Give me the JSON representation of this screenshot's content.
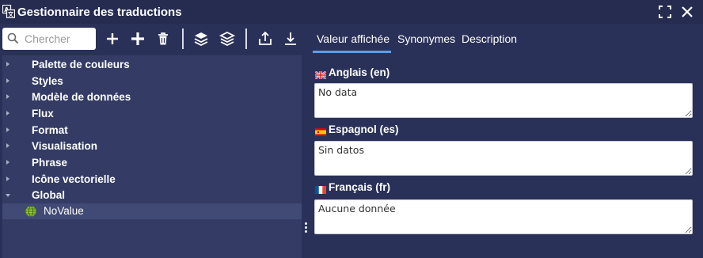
{
  "window": {
    "title": "Gestionnaire des traductions",
    "icon": "translate-icon",
    "controls": [
      "fullscreen-icon",
      "close-icon"
    ]
  },
  "toolbar": {
    "search_placeholder": "Chercher",
    "buttons": [
      "add-icon",
      "add-bold-icon",
      "trash-icon",
      "layers-icon",
      "layers-alt-icon",
      "export-icon",
      "download-icon"
    ]
  },
  "tree": {
    "items": [
      {
        "label": "Palette de couleurs",
        "expanded": false
      },
      {
        "label": "Styles",
        "expanded": false
      },
      {
        "label": "Modèle de données",
        "expanded": false
      },
      {
        "label": "Flux",
        "expanded": false
      },
      {
        "label": "Format",
        "expanded": false
      },
      {
        "label": "Visualisation",
        "expanded": false
      },
      {
        "label": "Phrase",
        "expanded": false
      },
      {
        "label": "Icône vectorielle",
        "expanded": false
      },
      {
        "label": "Global",
        "expanded": true
      }
    ],
    "selected_leaf": {
      "label": "NoValue",
      "icon": "globe-icon"
    }
  },
  "tabs": [
    {
      "label": "Valeur affichée",
      "active": true
    },
    {
      "label": "Synonymes",
      "active": false
    },
    {
      "label": "Description",
      "active": false
    }
  ],
  "languages": [
    {
      "label": "Anglais (en)",
      "flag": "uk-flag-icon",
      "value": "No data"
    },
    {
      "label": "Espagnol (es)",
      "flag": "spain-flag-icon",
      "value": "Sin datos"
    },
    {
      "label": "Français (fr)",
      "flag": "france-flag-icon",
      "value": "Aucune donnée"
    }
  ],
  "colors": {
    "background": "#2a3158",
    "titlebar": "#262c50",
    "tree_panel": "#343c65",
    "selected_row": "#404a75",
    "tab_accent": "#5b9ee8"
  }
}
